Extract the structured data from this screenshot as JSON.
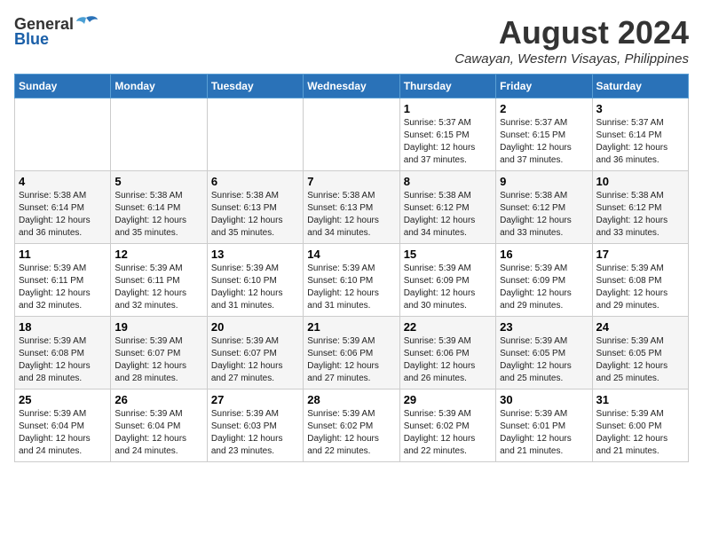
{
  "logo": {
    "general": "General",
    "blue": "Blue"
  },
  "title": {
    "month_year": "August 2024",
    "location": "Cawayan, Western Visayas, Philippines"
  },
  "headers": [
    "Sunday",
    "Monday",
    "Tuesday",
    "Wednesday",
    "Thursday",
    "Friday",
    "Saturday"
  ],
  "weeks": [
    [
      {
        "day": "",
        "info": ""
      },
      {
        "day": "",
        "info": ""
      },
      {
        "day": "",
        "info": ""
      },
      {
        "day": "",
        "info": ""
      },
      {
        "day": "1",
        "info": "Sunrise: 5:37 AM\nSunset: 6:15 PM\nDaylight: 12 hours\nand 37 minutes."
      },
      {
        "day": "2",
        "info": "Sunrise: 5:37 AM\nSunset: 6:15 PM\nDaylight: 12 hours\nand 37 minutes."
      },
      {
        "day": "3",
        "info": "Sunrise: 5:37 AM\nSunset: 6:14 PM\nDaylight: 12 hours\nand 36 minutes."
      }
    ],
    [
      {
        "day": "4",
        "info": "Sunrise: 5:38 AM\nSunset: 6:14 PM\nDaylight: 12 hours\nand 36 minutes."
      },
      {
        "day": "5",
        "info": "Sunrise: 5:38 AM\nSunset: 6:14 PM\nDaylight: 12 hours\nand 35 minutes."
      },
      {
        "day": "6",
        "info": "Sunrise: 5:38 AM\nSunset: 6:13 PM\nDaylight: 12 hours\nand 35 minutes."
      },
      {
        "day": "7",
        "info": "Sunrise: 5:38 AM\nSunset: 6:13 PM\nDaylight: 12 hours\nand 34 minutes."
      },
      {
        "day": "8",
        "info": "Sunrise: 5:38 AM\nSunset: 6:12 PM\nDaylight: 12 hours\nand 34 minutes."
      },
      {
        "day": "9",
        "info": "Sunrise: 5:38 AM\nSunset: 6:12 PM\nDaylight: 12 hours\nand 33 minutes."
      },
      {
        "day": "10",
        "info": "Sunrise: 5:38 AM\nSunset: 6:12 PM\nDaylight: 12 hours\nand 33 minutes."
      }
    ],
    [
      {
        "day": "11",
        "info": "Sunrise: 5:39 AM\nSunset: 6:11 PM\nDaylight: 12 hours\nand 32 minutes."
      },
      {
        "day": "12",
        "info": "Sunrise: 5:39 AM\nSunset: 6:11 PM\nDaylight: 12 hours\nand 32 minutes."
      },
      {
        "day": "13",
        "info": "Sunrise: 5:39 AM\nSunset: 6:10 PM\nDaylight: 12 hours\nand 31 minutes."
      },
      {
        "day": "14",
        "info": "Sunrise: 5:39 AM\nSunset: 6:10 PM\nDaylight: 12 hours\nand 31 minutes."
      },
      {
        "day": "15",
        "info": "Sunrise: 5:39 AM\nSunset: 6:09 PM\nDaylight: 12 hours\nand 30 minutes."
      },
      {
        "day": "16",
        "info": "Sunrise: 5:39 AM\nSunset: 6:09 PM\nDaylight: 12 hours\nand 29 minutes."
      },
      {
        "day": "17",
        "info": "Sunrise: 5:39 AM\nSunset: 6:08 PM\nDaylight: 12 hours\nand 29 minutes."
      }
    ],
    [
      {
        "day": "18",
        "info": "Sunrise: 5:39 AM\nSunset: 6:08 PM\nDaylight: 12 hours\nand 28 minutes."
      },
      {
        "day": "19",
        "info": "Sunrise: 5:39 AM\nSunset: 6:07 PM\nDaylight: 12 hours\nand 28 minutes."
      },
      {
        "day": "20",
        "info": "Sunrise: 5:39 AM\nSunset: 6:07 PM\nDaylight: 12 hours\nand 27 minutes."
      },
      {
        "day": "21",
        "info": "Sunrise: 5:39 AM\nSunset: 6:06 PM\nDaylight: 12 hours\nand 27 minutes."
      },
      {
        "day": "22",
        "info": "Sunrise: 5:39 AM\nSunset: 6:06 PM\nDaylight: 12 hours\nand 26 minutes."
      },
      {
        "day": "23",
        "info": "Sunrise: 5:39 AM\nSunset: 6:05 PM\nDaylight: 12 hours\nand 25 minutes."
      },
      {
        "day": "24",
        "info": "Sunrise: 5:39 AM\nSunset: 6:05 PM\nDaylight: 12 hours\nand 25 minutes."
      }
    ],
    [
      {
        "day": "25",
        "info": "Sunrise: 5:39 AM\nSunset: 6:04 PM\nDaylight: 12 hours\nand 24 minutes."
      },
      {
        "day": "26",
        "info": "Sunrise: 5:39 AM\nSunset: 6:04 PM\nDaylight: 12 hours\nand 24 minutes."
      },
      {
        "day": "27",
        "info": "Sunrise: 5:39 AM\nSunset: 6:03 PM\nDaylight: 12 hours\nand 23 minutes."
      },
      {
        "day": "28",
        "info": "Sunrise: 5:39 AM\nSunset: 6:02 PM\nDaylight: 12 hours\nand 22 minutes."
      },
      {
        "day": "29",
        "info": "Sunrise: 5:39 AM\nSunset: 6:02 PM\nDaylight: 12 hours\nand 22 minutes."
      },
      {
        "day": "30",
        "info": "Sunrise: 5:39 AM\nSunset: 6:01 PM\nDaylight: 12 hours\nand 21 minutes."
      },
      {
        "day": "31",
        "info": "Sunrise: 5:39 AM\nSunset: 6:00 PM\nDaylight: 12 hours\nand 21 minutes."
      }
    ]
  ]
}
